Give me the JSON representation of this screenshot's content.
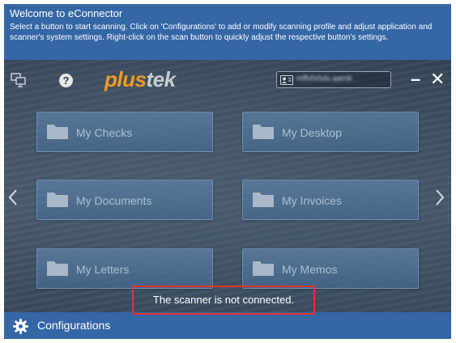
{
  "welcome": {
    "title": "Welcome to  eConnector",
    "text": "Select a button to start scanning.  Click on 'Configurations' to add or modify scanning profile and adjust application and scanner's system settings.  Right-click on the scan button to quickly adjust the respective button's settings."
  },
  "header": {
    "logo_part1": "plus",
    "logo_part2": "tek",
    "user_text": "mflvhrlvls.aamk",
    "minimize_label": "–",
    "close_label": "✕",
    "help_label": "?"
  },
  "icons": {
    "monitor": "monitor-network-icon",
    "help": "help-icon",
    "user": "user-card-icon",
    "folder": "folder-icon",
    "gear": "gear-icon",
    "left": "chevron-left-icon",
    "right": "chevron-right-icon"
  },
  "buttons": [
    {
      "label": "My Checks"
    },
    {
      "label": "My Desktop"
    },
    {
      "label": "My Documents"
    },
    {
      "label": "My Invoices"
    },
    {
      "label": "My Letters"
    },
    {
      "label": "My Memos"
    }
  ],
  "status": {
    "message": "The scanner is not connected."
  },
  "footer": {
    "config_label": "Configurations"
  },
  "colors": {
    "accent_blue": "#3566a6",
    "logo_orange": "#f29a1f",
    "status_border": "#e0342f"
  }
}
